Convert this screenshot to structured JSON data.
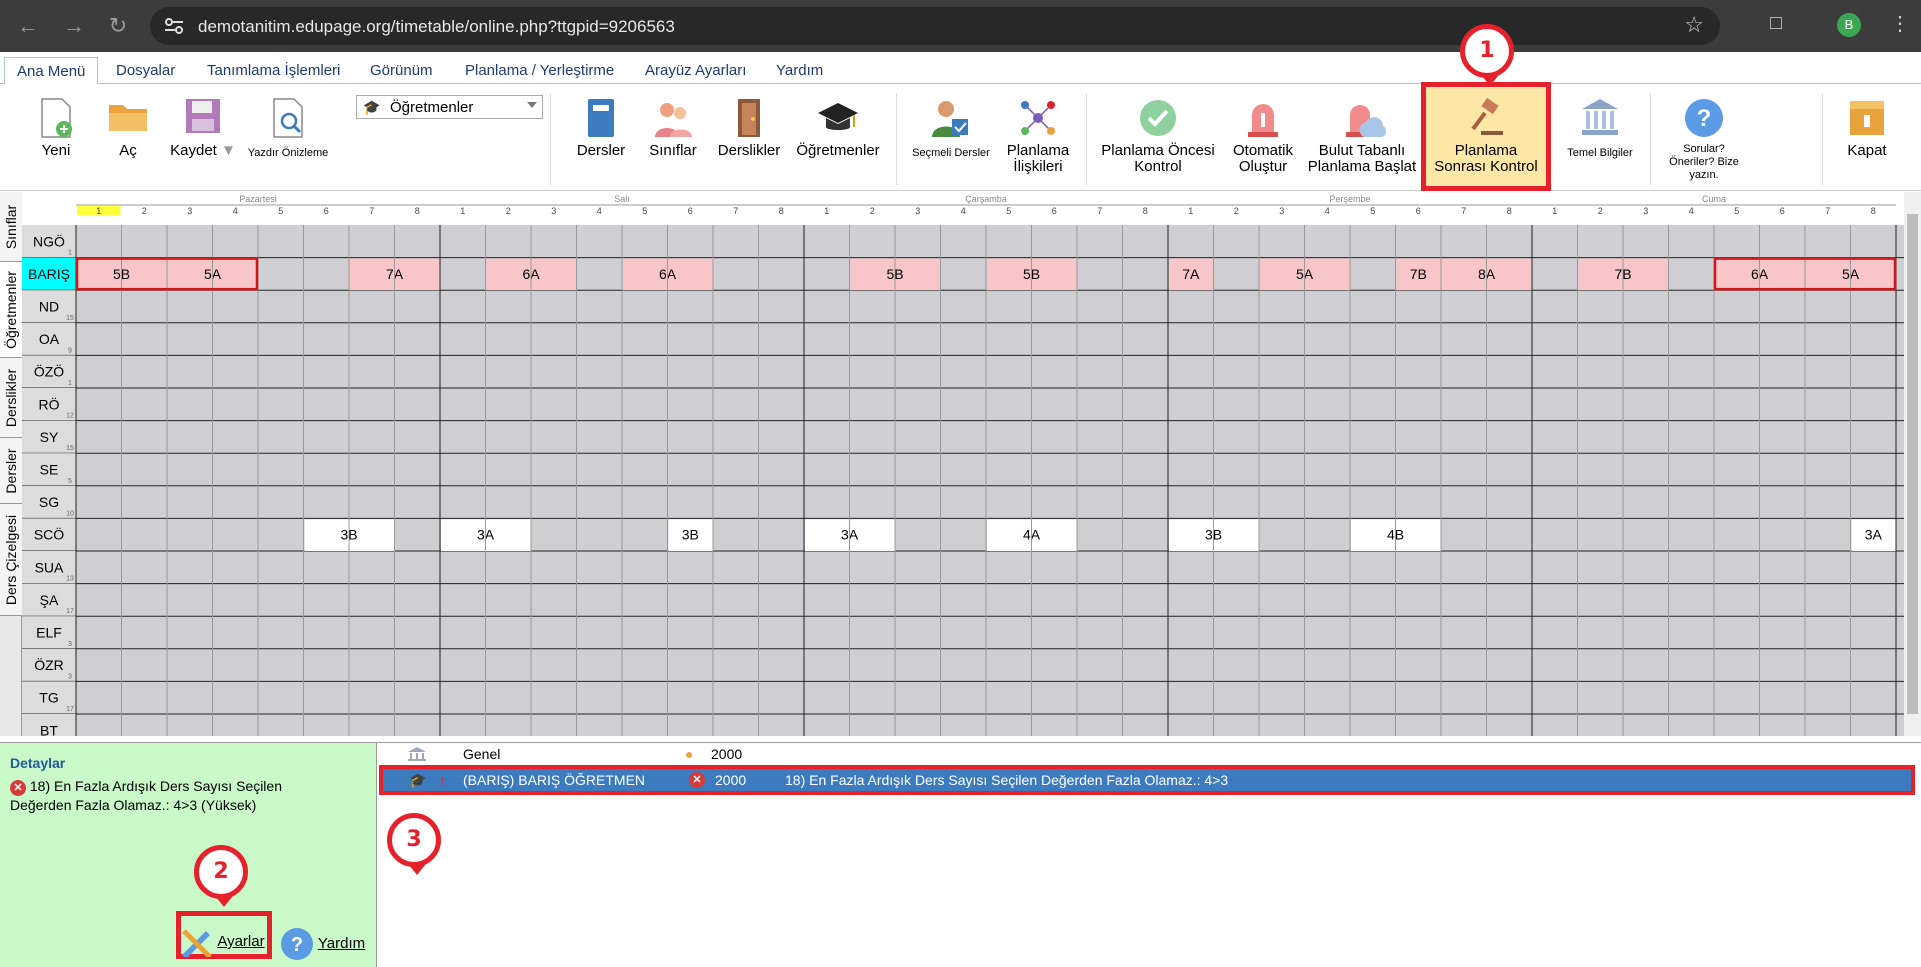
{
  "browser": {
    "url": "demotanitim.edupage.org/timetable/online.php?ttgpid=9206563",
    "profile_initial": "B"
  },
  "menu": {
    "tabs": [
      "Ana Menü",
      "Dosyalar",
      "Tanımlama İşlemleri",
      "Görünüm",
      "Planlama / Yerleştirme",
      "Arayüz Ayarları",
      "Yardım"
    ],
    "active": "Ana Menü"
  },
  "ribbon": {
    "new": "Yeni",
    "open": "Aç",
    "save": "Kaydet",
    "print_preview": "Yazdır Önizleme",
    "select_value": "Öğretmenler",
    "lessons": "Dersler",
    "classes": "Sınıflar",
    "classrooms": "Derslikler",
    "teachers": "Öğretmenler",
    "elective": "Seçmeli Dersler",
    "relations": "Planlama\nİlişkileri",
    "pre_check": "Planlama Öncesi\nKontrol",
    "auto_generate": "Otomatik\nOluştur",
    "cloud_start": "Bulut Tabanlı\nPlanlama Başlat",
    "post_check": "Planlama\nSonrası Kontrol",
    "basic_info": "Temel Bilgiler",
    "feedback": "Sorular?\nÖneriler? Bize\nyazın.",
    "close": "Kapat"
  },
  "annotations": {
    "badge1": "1",
    "badge2": "2",
    "badge3": "3"
  },
  "side_tabs": [
    "Sınıflar",
    "Öğretmenler",
    "Derslikler",
    "Dersler",
    "Ders Çizelgesi"
  ],
  "timetable": {
    "days": [
      "Pazartesi",
      "Salı",
      "Çarşamba",
      "Perşembe",
      "Cuma"
    ],
    "periods": [
      "1",
      "2",
      "3",
      "4",
      "5",
      "6",
      "7",
      "8"
    ],
    "rows": [
      {
        "name": "NGÖ",
        "sub": "1"
      },
      {
        "name": "BARIŞ",
        "sub": "",
        "selected": true
      },
      {
        "name": "ND",
        "sub": "15"
      },
      {
        "name": "OA",
        "sub": "9"
      },
      {
        "name": "ÖZÖ",
        "sub": "1"
      },
      {
        "name": "RÖ",
        "sub": "12"
      },
      {
        "name": "SY",
        "sub": "15"
      },
      {
        "name": "SE",
        "sub": "5"
      },
      {
        "name": "SG",
        "sub": "10"
      },
      {
        "name": "SCÖ",
        "sub": ""
      },
      {
        "name": "SUA",
        "sub": "13"
      },
      {
        "name": "ŞA",
        "sub": "17"
      },
      {
        "name": "ELF",
        "sub": "3"
      },
      {
        "name": "ÖZR",
        "sub": "3"
      },
      {
        "name": "TG",
        "sub": "17"
      },
      {
        "name": "BT",
        "sub": ""
      }
    ],
    "cards": [
      {
        "row": 1,
        "day": 0,
        "start": 0,
        "span": 2,
        "label": "5B",
        "kind": "pink"
      },
      {
        "row": 1,
        "day": 0,
        "start": 2,
        "span": 2,
        "label": "5A",
        "kind": "pink"
      },
      {
        "row": 1,
        "day": 0,
        "start": 6,
        "span": 2,
        "label": "7A",
        "kind": "pink"
      },
      {
        "row": 1,
        "day": 1,
        "start": 1,
        "span": 2,
        "label": "6A",
        "kind": "pink"
      },
      {
        "row": 1,
        "day": 1,
        "start": 4,
        "span": 2,
        "label": "6A",
        "kind": "pink"
      },
      {
        "row": 1,
        "day": 2,
        "start": 1,
        "span": 2,
        "label": "5B",
        "kind": "pink"
      },
      {
        "row": 1,
        "day": 2,
        "start": 4,
        "span": 2,
        "label": "5B",
        "kind": "pink"
      },
      {
        "row": 1,
        "day": 3,
        "start": 0,
        "span": 1,
        "label": "7A",
        "kind": "pink"
      },
      {
        "row": 1,
        "day": 3,
        "start": 2,
        "span": 2,
        "label": "5A",
        "kind": "pink"
      },
      {
        "row": 1,
        "day": 3,
        "start": 5,
        "span": 1,
        "label": "7B",
        "kind": "pink"
      },
      {
        "row": 1,
        "day": 3,
        "start": 6,
        "span": 2,
        "label": "8A",
        "kind": "pink"
      },
      {
        "row": 1,
        "day": 4,
        "start": 1,
        "span": 2,
        "label": "7B",
        "kind": "pink"
      },
      {
        "row": 1,
        "day": 4,
        "start": 4,
        "span": 2,
        "label": "6A",
        "kind": "pink"
      },
      {
        "row": 1,
        "day": 4,
        "start": 6,
        "span": 2,
        "label": "5A",
        "kind": "pink"
      },
      {
        "row": 9,
        "day": 0,
        "start": 5,
        "span": 2,
        "label": "3B",
        "kind": "white"
      },
      {
        "row": 9,
        "day": 1,
        "start": 0,
        "span": 2,
        "label": "3A",
        "kind": "white"
      },
      {
        "row": 9,
        "day": 1,
        "start": 5,
        "span": 1,
        "label": "3B",
        "kind": "white"
      },
      {
        "row": 9,
        "day": 2,
        "start": 0,
        "span": 2,
        "label": "3A",
        "kind": "white"
      },
      {
        "row": 9,
        "day": 2,
        "start": 4,
        "span": 2,
        "label": "4A",
        "kind": "white"
      },
      {
        "row": 9,
        "day": 3,
        "start": 0,
        "span": 2,
        "label": "3B",
        "kind": "white"
      },
      {
        "row": 9,
        "day": 3,
        "start": 4,
        "span": 2,
        "label": "4B",
        "kind": "white"
      },
      {
        "row": 9,
        "day": 4,
        "start": 7,
        "span": 1,
        "label": "3A",
        "kind": "white"
      }
    ]
  },
  "details": {
    "title": "Detaylar",
    "text": "18) En Fazla Ardışık Ders Sayısı Seçilen Değerden Fazla Olamaz.: 4>3 (Yüksek)",
    "settings": "Ayarlar",
    "help": "Yardım"
  },
  "results": [
    {
      "name": "Genel",
      "value": "2000",
      "message": "",
      "selected": false
    },
    {
      "name": "(BARIŞ) BARIŞ ÖĞRETMEN",
      "value": "2000",
      "message": "18) En Fazla Ardışık Ders Sayısı Seçilen Değerden Fazla Olamaz.: 4>3",
      "selected": true
    }
  ],
  "colors": {
    "card_pink": "#f8c6c8",
    "card_white": "#ffffff",
    "accent_red": "#e6212b",
    "selected_row": "#3d7bbf",
    "highlight_row": "#00ffff"
  }
}
